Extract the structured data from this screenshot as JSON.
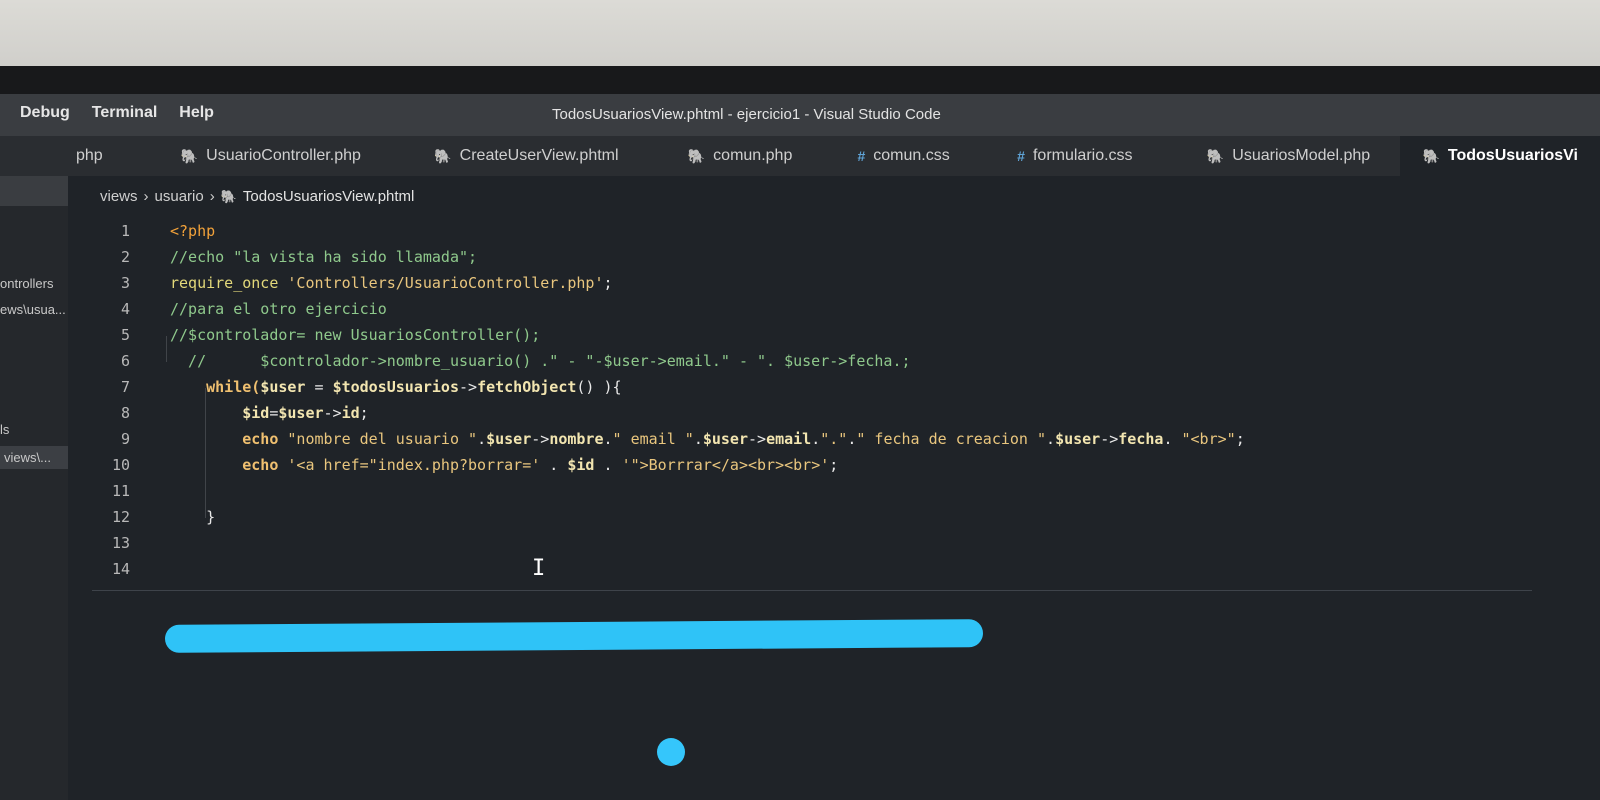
{
  "window": {
    "title": "TodosUsuariosView.phtml - ejercicio1 - Visual Studio Code",
    "menu": [
      "Debug",
      "Terminal",
      "Help"
    ]
  },
  "tabs": [
    {
      "label": "php",
      "icon": "none"
    },
    {
      "label": "UsuarioController.php",
      "icon": "php-elephant-icon"
    },
    {
      "label": "CreateUserView.phtml",
      "icon": "php-elephant-icon"
    },
    {
      "label": "comun.php",
      "icon": "php-elephant-icon"
    },
    {
      "label": "comun.css",
      "icon": "css-hash-icon"
    },
    {
      "label": "formulario.css",
      "icon": "css-hash-icon"
    },
    {
      "label": "UsuariosModel.php",
      "icon": "php-elephant-icon"
    },
    {
      "label": "TodosUsuariosVi",
      "icon": "php-elephant-icon",
      "active": true
    }
  ],
  "breadcrumb": [
    "views",
    "usuario",
    "TodosUsuariosView.phtml"
  ],
  "sidebar": [
    "ontrollers",
    "ews\\usua...",
    "ls",
    "views\\..."
  ],
  "editor": {
    "line_numbers": [
      "1",
      "2",
      "3",
      "4",
      "5",
      "6",
      "7",
      "8",
      "9",
      "10",
      "11",
      "12",
      "13",
      "14"
    ],
    "lines": [
      [
        {
          "t": "<?php",
          "c": "k"
        }
      ],
      [
        {
          "t": "//echo \"la vista ha sido llamada\";",
          "c": "c"
        }
      ],
      [
        {
          "t": "require_once",
          "c": "t"
        },
        {
          "t": " ",
          "c": "f"
        },
        {
          "t": "'Controllers/UsuarioController.php'",
          "c": "s"
        },
        {
          "t": ";",
          "c": "f"
        }
      ],
      [
        {
          "t": "//para el otro ejercicio",
          "c": "c"
        }
      ],
      [
        {
          "t": "//$controlador= new UsuariosController();",
          "c": "c"
        }
      ],
      [
        {
          "t": "  //      $controlador->nombre_usuario() .\" - \"-$user->email.\" - \". $user->fecha.;",
          "c": "c"
        }
      ],
      [
        {
          "t": "    while(",
          "c": "kb"
        },
        {
          "t": "$user",
          "c": "v"
        },
        {
          "t": " = ",
          "c": "f"
        },
        {
          "t": "$todosUsuarios",
          "c": "v"
        },
        {
          "t": "->",
          "c": "f"
        },
        {
          "t": "fetchObject",
          "c": "v"
        },
        {
          "t": "() ){",
          "c": "f"
        }
      ],
      [
        {
          "t": "        $id",
          "c": "v"
        },
        {
          "t": "=",
          "c": "f"
        },
        {
          "t": "$user",
          "c": "v"
        },
        {
          "t": "->",
          "c": "f"
        },
        {
          "t": "id",
          "c": "v"
        },
        {
          "t": ";",
          "c": "f"
        }
      ],
      [
        {
          "t": "        echo ",
          "c": "kb"
        },
        {
          "t": "\"nombre del usuario \"",
          "c": "s"
        },
        {
          "t": ".",
          "c": "f"
        },
        {
          "t": "$user",
          "c": "v"
        },
        {
          "t": "->",
          "c": "f"
        },
        {
          "t": "nombre",
          "c": "v"
        },
        {
          "t": ".",
          "c": "f"
        },
        {
          "t": "\" email \"",
          "c": "s"
        },
        {
          "t": ".",
          "c": "f"
        },
        {
          "t": "$user",
          "c": "v"
        },
        {
          "t": "->",
          "c": "f"
        },
        {
          "t": "email",
          "c": "v"
        },
        {
          "t": ".",
          "c": "f"
        },
        {
          "t": "\".\"",
          "c": "s"
        },
        {
          "t": ".",
          "c": "f"
        },
        {
          "t": "\" fecha de creacion \"",
          "c": "s"
        },
        {
          "t": ".",
          "c": "f"
        },
        {
          "t": "$user",
          "c": "v"
        },
        {
          "t": "->",
          "c": "f"
        },
        {
          "t": "fecha",
          "c": "v"
        },
        {
          "t": ". ",
          "c": "f"
        },
        {
          "t": "\"<br>\"",
          "c": "s"
        },
        {
          "t": ";",
          "c": "f"
        }
      ],
      [
        {
          "t": "        echo ",
          "c": "kb"
        },
        {
          "t": "'<a href=\"index.php?borrar='",
          "c": "s"
        },
        {
          "t": " . ",
          "c": "f"
        },
        {
          "t": "$id",
          "c": "v"
        },
        {
          "t": " . ",
          "c": "f"
        },
        {
          "t": "'\">Borrrar</a><br><br>'",
          "c": "s"
        },
        {
          "t": ";",
          "c": "f"
        }
      ],
      [],
      [
        {
          "t": "    }",
          "c": "f"
        }
      ],
      [],
      []
    ]
  },
  "colors": {
    "background": "#1f2328",
    "titlebar": "#3a3d41",
    "marker": "#2fc3f7"
  }
}
